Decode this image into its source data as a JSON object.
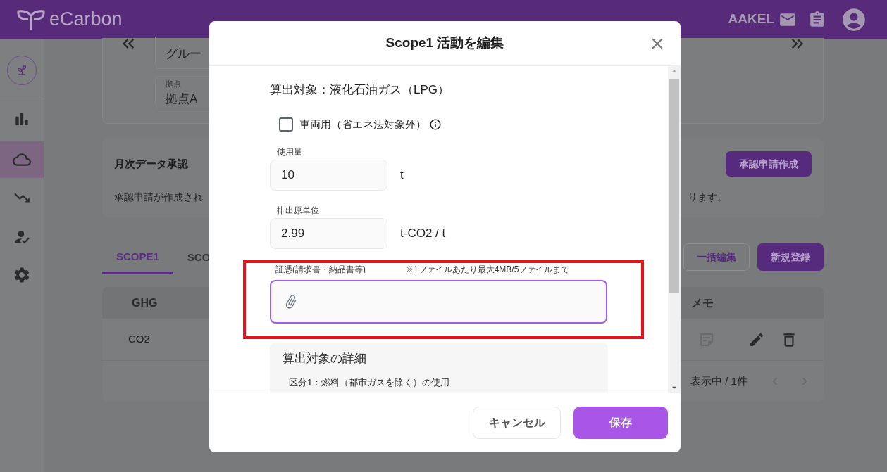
{
  "header": {
    "logo": "eCarbon",
    "user": "AAKEL"
  },
  "sidebar": {
    "items": [
      {
        "kind": "sprout",
        "selected": false
      },
      {
        "kind": "chart",
        "selected": false
      },
      {
        "kind": "cloud",
        "selected": true
      },
      {
        "kind": "trend",
        "selected": false
      },
      {
        "kind": "approver",
        "selected": false
      },
      {
        "kind": "settings",
        "selected": false
      }
    ]
  },
  "filter": {
    "group_value": "グルー",
    "site_label": "拠点",
    "site_value": "拠点A"
  },
  "approval": {
    "title": "月次データ承認",
    "text_left": "承認申請が作成され",
    "text_right": "ります。",
    "button": "承認申請作成"
  },
  "tabs": [
    {
      "label": "SCOPE1",
      "selected": true
    },
    {
      "label": "SCO",
      "selected": false
    }
  ],
  "actions": [
    {
      "label": "一括編集",
      "kind": "outline"
    },
    {
      "label": "新規登録",
      "kind": "filled"
    }
  ],
  "table": {
    "columns": [
      "GHG",
      "メモ"
    ],
    "rows": [
      {
        "ghg": "CO2"
      }
    ],
    "pagination": "表示中 / 1件"
  },
  "dialog": {
    "title": "Scope1 活動を編集",
    "target": "算出対象：液化石油ガス（LPG）",
    "checkbox": {
      "label": "車両用（省エネ法対象外）",
      "checked": false
    },
    "fields": [
      {
        "label": "使用量",
        "value": "10",
        "unit": "t"
      },
      {
        "label": "排出原単位",
        "value": "2.99",
        "unit": "t-CO2 / t"
      }
    ],
    "evidence": {
      "label": "証憑(請求書・納品書等)",
      "note": "※1ファイルあたり最大4MB/5ファイルまで",
      "highlighted": true
    },
    "details": {
      "title": "算出対象の詳細",
      "line": "区分1：燃料（都市ガスを除く）の使用"
    },
    "buttons": [
      {
        "label": "キャンセル",
        "kind": "secondary"
      },
      {
        "label": "保存",
        "kind": "primary"
      }
    ]
  }
}
